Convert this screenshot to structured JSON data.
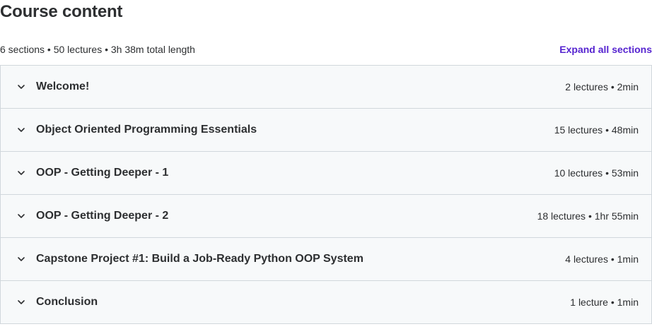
{
  "header": {
    "title": "Course content",
    "summary": "6 sections • 50 lectures • 3h 38m total length",
    "expand_label": "Expand all sections"
  },
  "colors": {
    "accent": "#5624d0",
    "text": "#2d2f31",
    "section_bg": "#f7f9fa",
    "border": "#d1d7dc"
  },
  "sections": [
    {
      "title": "Welcome!",
      "meta": "2 lectures • 2min",
      "icon": "chevron-down-icon"
    },
    {
      "title": "Object Oriented Programming Essentials",
      "meta": "15 lectures • 48min",
      "icon": "chevron-down-icon"
    },
    {
      "title": "OOP - Getting Deeper - 1",
      "meta": "10 lectures • 53min",
      "icon": "chevron-down-icon"
    },
    {
      "title": "OOP - Getting Deeper - 2",
      "meta": "18 lectures • 1hr 55min",
      "icon": "chevron-down-icon"
    },
    {
      "title": "Capstone Project #1: Build a Job-Ready Python OOP System",
      "meta": "4 lectures • 1min",
      "icon": "chevron-down-icon"
    },
    {
      "title": "Conclusion",
      "meta": "1 lecture • 1min",
      "icon": "chevron-down-icon"
    }
  ]
}
